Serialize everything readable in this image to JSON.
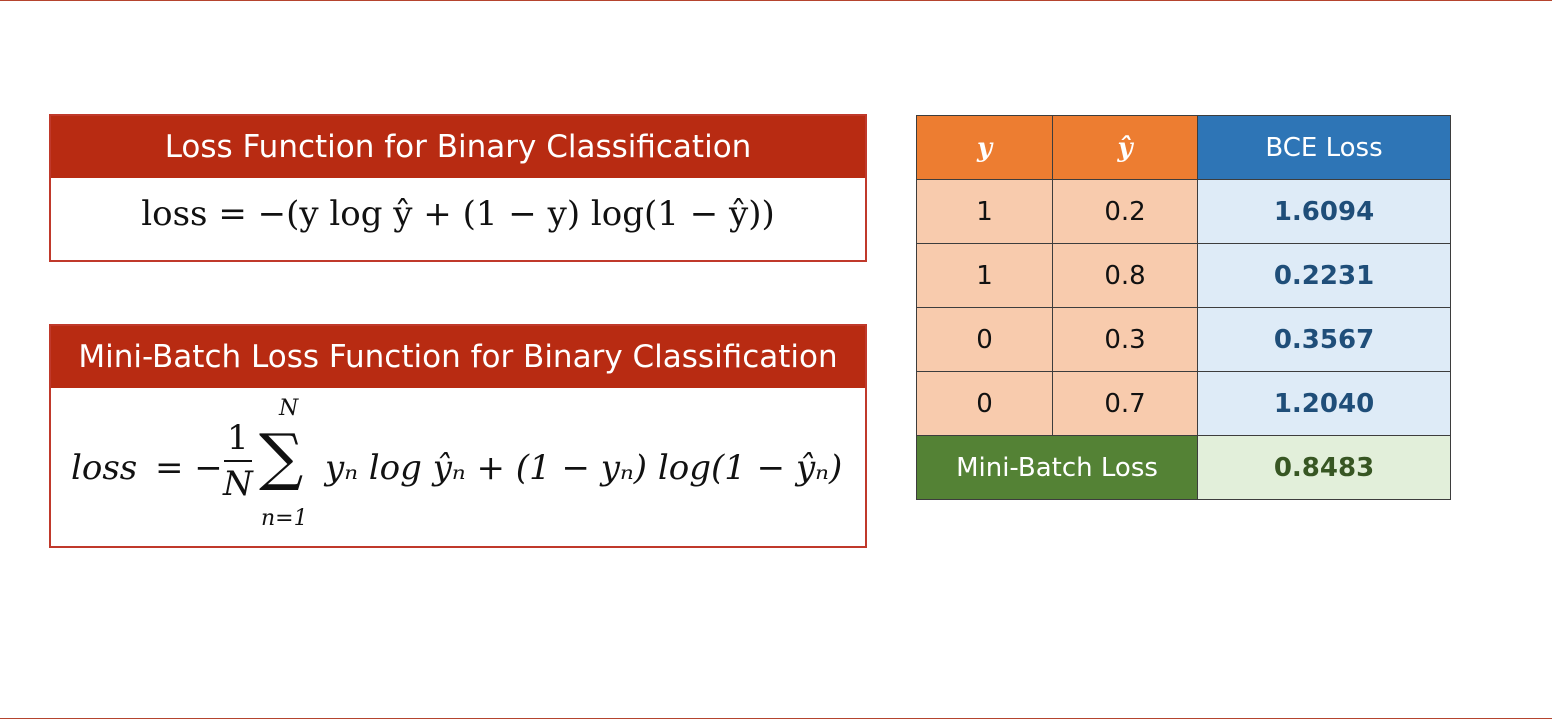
{
  "box1": {
    "title": "Loss Function for Binary Classification",
    "formula": "loss = −(y log ŷ + (1 − y) log(1 − ŷ))"
  },
  "box2": {
    "title": "Mini-Batch Loss Function for Binary Classification",
    "formula": {
      "lhs": "loss",
      "eq": "= −",
      "num": "1",
      "den": "N",
      "sum": "∑",
      "upper": "N",
      "lower": "n=1",
      "rhs": "yₙ log ŷₙ + (1 − yₙ) log(1 − ŷₙ)"
    }
  },
  "table": {
    "headers": [
      "y",
      "ŷ",
      "BCE Loss"
    ],
    "rows": [
      [
        "1",
        "0.2",
        "1.6094"
      ],
      [
        "1",
        "0.8",
        "0.2231"
      ],
      [
        "0",
        "0.3",
        "0.3567"
      ],
      [
        "0",
        "0.7",
        "1.2040"
      ]
    ],
    "footer_label": "Mini-Batch Loss",
    "footer_value": "0.8483"
  },
  "colors": {
    "title_bar": "#b82b12",
    "header_orange": "#ed7d31",
    "header_blue": "#2e75b6",
    "cell_orange": "#f8cbad",
    "cell_blue": "#deebf7",
    "footer_green": "#548235",
    "footer_light_green": "#e2efda"
  }
}
